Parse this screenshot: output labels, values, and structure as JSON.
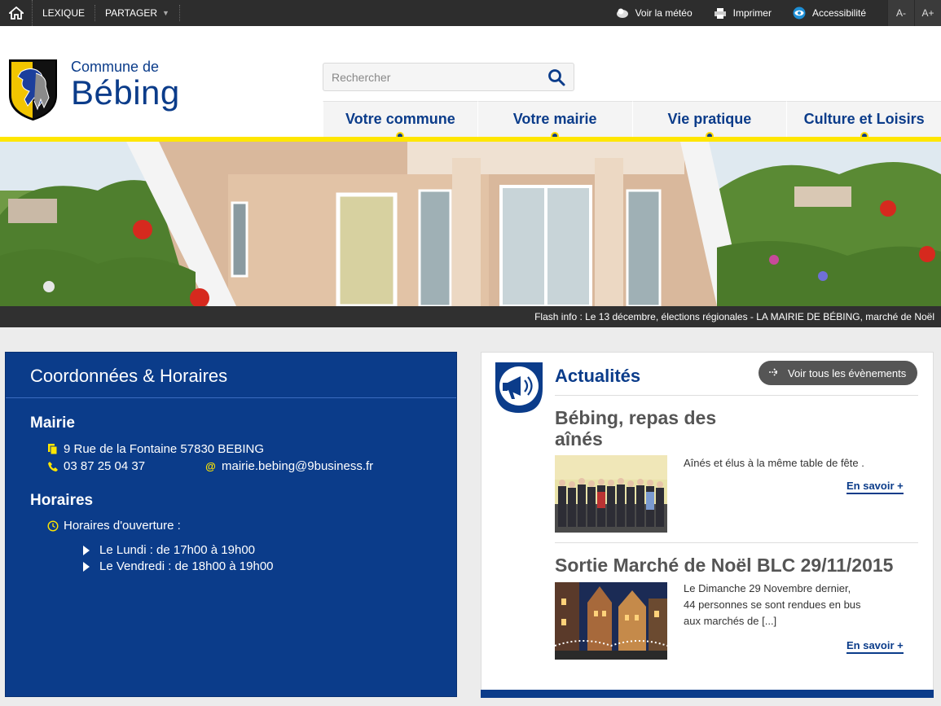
{
  "topbar": {
    "lexique": "LEXIQUE",
    "partager": "PARTAGER",
    "meteo": "Voir la météo",
    "imprimer": "Imprimer",
    "accessibilite": "Accessibilité",
    "font_smaller": "A-",
    "font_larger": "A+"
  },
  "header": {
    "logo_pre": "Commune de",
    "logo_name": "Bébing"
  },
  "search": {
    "placeholder": "Rechercher"
  },
  "nav": {
    "item1": "Votre commune",
    "item2": "Votre mairie",
    "item3": "Vie pratique",
    "item4": "Culture et Loisirs"
  },
  "ticker": {
    "text": "Flash info : Le 13 décembre, élections régionales - LA MAIRIE DE BÉBING, marché de Noël"
  },
  "contact": {
    "title": "Coordonnées & Horaires",
    "mairie_heading": "Mairie",
    "address": "9 Rue de la Fontaine 57830 BEBING",
    "phone": "03 87 25 04 37",
    "email": "mairie.bebing@9business.fr",
    "horaires_heading": "Horaires",
    "horaires_label": "Horaires d'ouverture :",
    "slot1": "Le Lundi : de 17h00 à 19h00",
    "slot2": "Le Vendredi : de 18h00 à 19h00"
  },
  "news": {
    "title": "Actualités",
    "all_button": "Voir tous les évènements",
    "article1": {
      "title": "Bébing, repas des aînés",
      "summary": "Aînés et élus à la même table de fête .",
      "more": "En savoir +"
    },
    "article2": {
      "title": "Sortie Marché de Noël BLC 29/11/2015",
      "summary": "Le Dimanche 29 Novembre dernier, 44 personnes se sont rendues en bus aux marchés de [...]",
      "more": "En savoir +"
    }
  },
  "colors": {
    "brand_blue": "#0b3c8a",
    "accent_yellow": "#ffe600",
    "topbar_dark": "#2d2d2d"
  }
}
